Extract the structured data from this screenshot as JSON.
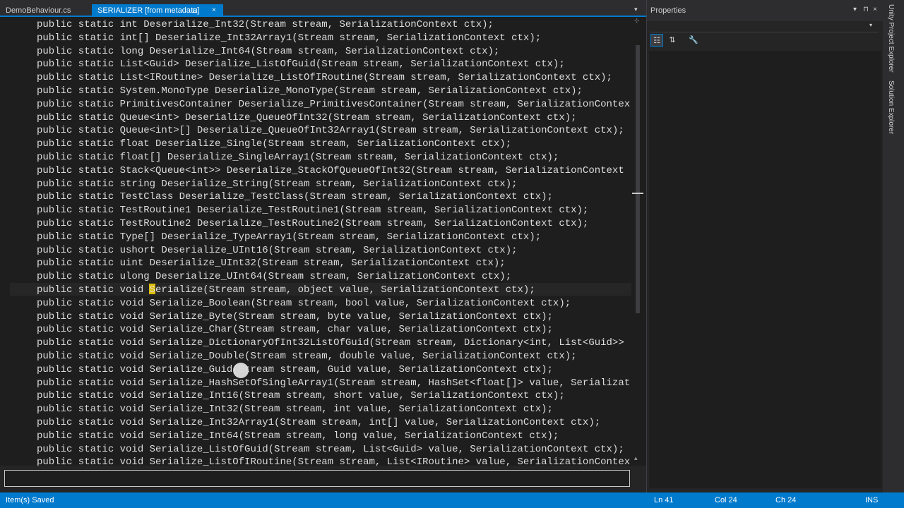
{
  "tabs": [
    {
      "label": "DemoBehaviour.cs"
    },
    {
      "label": "SERIALIZER [from metadata]",
      "pin": "⊟",
      "close": "×"
    }
  ],
  "overflow_glyph": "▾",
  "code_lines": [
    "public static int Deserialize_Int32(Stream stream, SerializationContext ctx);",
    "public static int[] Deserialize_Int32Array1(Stream stream, SerializationContext ctx);",
    "public static long Deserialize_Int64(Stream stream, SerializationContext ctx);",
    "public static List<Guid> Deserialize_ListOfGuid(Stream stream, SerializationContext ctx);",
    "public static List<IRoutine> Deserialize_ListOfIRoutine(Stream stream, SerializationContext ctx);",
    "public static System.MonoType Deserialize_MonoType(Stream stream, SerializationContext ctx);",
    "public static PrimitivesContainer Deserialize_PrimitivesContainer(Stream stream, SerializationContex",
    "public static Queue<int> Deserialize_QueueOfInt32(Stream stream, SerializationContext ctx);",
    "public static Queue<int>[] Deserialize_QueueOfInt32Array1(Stream stream, SerializationContext ctx);",
    "public static float Deserialize_Single(Stream stream, SerializationContext ctx);",
    "public static float[] Deserialize_SingleArray1(Stream stream, SerializationContext ctx);",
    "public static Stack<Queue<int>> Deserialize_StackOfQueueOfInt32(Stream stream, SerializationContext",
    "public static string Deserialize_String(Stream stream, SerializationContext ctx);",
    "public static TestClass Deserialize_TestClass(Stream stream, SerializationContext ctx);",
    "public static TestRoutine1 Deserialize_TestRoutine1(Stream stream, SerializationContext ctx);",
    "public static TestRoutine2 Deserialize_TestRoutine2(Stream stream, SerializationContext ctx);",
    "public static Type[] Deserialize_TypeArray1(Stream stream, SerializationContext ctx);",
    "public static ushort Deserialize_UInt16(Stream stream, SerializationContext ctx);",
    "public static uint Deserialize_UInt32(Stream stream, SerializationContext ctx);",
    "public static ulong Deserialize_UInt64(Stream stream, SerializationContext ctx);",
    "public static void Serialize(Stream stream, object value, SerializationContext ctx);",
    "public static void Serialize_Boolean(Stream stream, bool value, SerializationContext ctx);",
    "public static void Serialize_Byte(Stream stream, byte value, SerializationContext ctx);",
    "public static void Serialize_Char(Stream stream, char value, SerializationContext ctx);",
    "public static void Serialize_DictionaryOfInt32ListOfGuid(Stream stream, Dictionary<int, List<Guid>>",
    "public static void Serialize_Double(Stream stream, double value, SerializationContext ctx);",
    "public static void Serialize_Guid(Stream stream, Guid value, SerializationContext ctx);",
    "public static void Serialize_HashSetOfSingleArray1(Stream stream, HashSet<float[]> value, Serializat",
    "public static void Serialize_Int16(Stream stream, short value, SerializationContext ctx);",
    "public static void Serialize_Int32(Stream stream, int value, SerializationContext ctx);",
    "public static void Serialize_Int32Array1(Stream stream, int[] value, SerializationContext ctx);",
    "public static void Serialize_Int64(Stream stream, long value, SerializationContext ctx);",
    "public static void Serialize_ListOfGuid(Stream stream, List<Guid> value, SerializationContext ctx);",
    "public static void Serialize_ListOfIRoutine(Stream stream, List<IRoutine> value, SerializationContex"
  ],
  "scrollbar": {
    "up": "⊹",
    "down": "▴"
  },
  "properties": {
    "title": "Properties",
    "controls": {
      "dropdown": "▾",
      "pin": "⊓",
      "close": "×"
    },
    "dropdown_chevron": "▾",
    "tools": [
      {
        "icon": "categorized-icon",
        "glyph": "☷"
      },
      {
        "icon": "alphabetical-icon",
        "glyph": "⇅"
      },
      {
        "icon": "property-pages-icon",
        "glyph": "🔧"
      }
    ]
  },
  "side_tabs": [
    "Unity Project Explorer",
    "Solution Explorer"
  ],
  "status": {
    "message": "Item(s) Saved",
    "line": "Ln 41",
    "col": "Col 24",
    "ch": "Ch 24",
    "mode": "INS"
  },
  "colors": {
    "accent": "#007acc",
    "editor_bg": "#1e1e1e",
    "caret_highlight": "#ffd700"
  }
}
